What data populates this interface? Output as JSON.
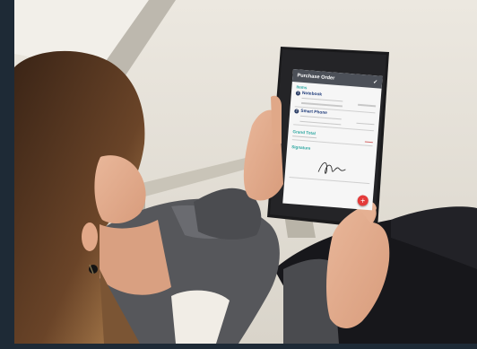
{
  "image": {
    "description_colors": {
      "background_floor": "#e3dfd6",
      "tablet_body": "#1b1b1d",
      "jacket": "#535457",
      "pants": "#141418",
      "hair": "#5b3a22"
    }
  },
  "tablet_screen": {
    "title": "Purchase Order",
    "check_icon": "✓",
    "items_header": "Items",
    "items": [
      {
        "index": "1",
        "name": "Notebook"
      },
      {
        "index": "2",
        "name": "Smart Phone"
      }
    ],
    "grand_total_header": "Grand Total",
    "signature_header": "Signature",
    "fab_label": "+"
  }
}
